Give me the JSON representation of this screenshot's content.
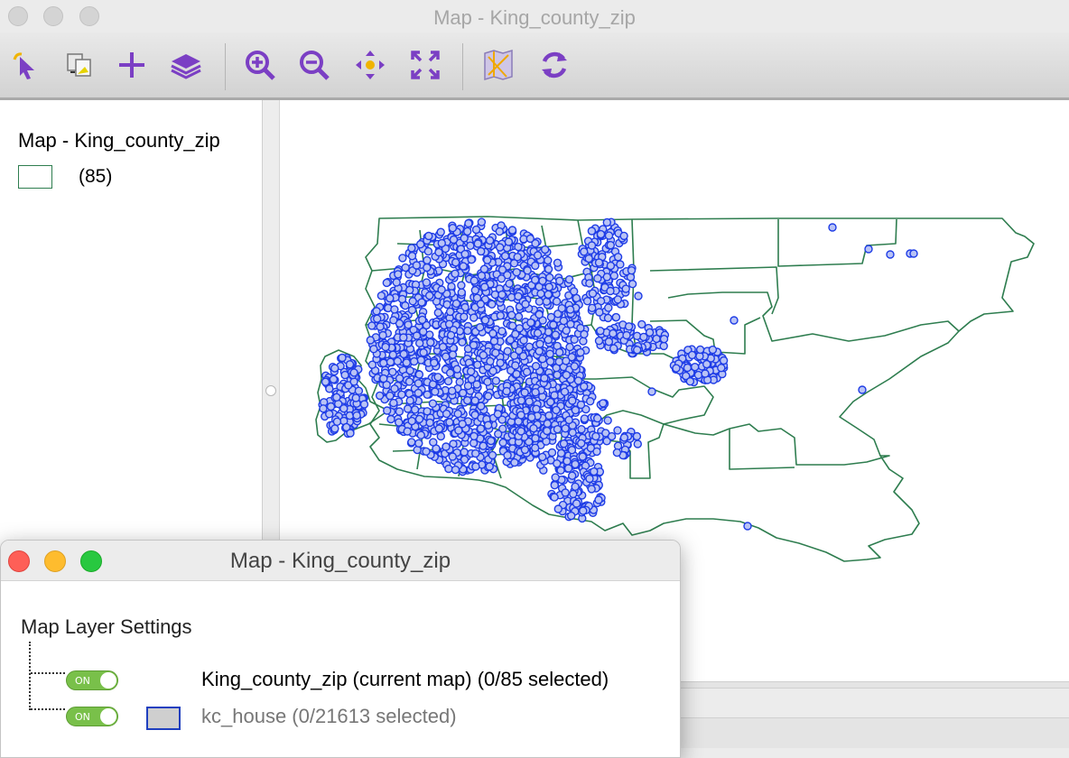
{
  "main_window": {
    "title": "Map - King_county_zip"
  },
  "toolbar": {
    "buttons": [
      {
        "icon": "select-pointer-icon",
        "name": "Select"
      },
      {
        "icon": "copy-image-icon",
        "name": "Copy"
      },
      {
        "icon": "add-layer-plus-icon",
        "name": "Add layer"
      },
      {
        "icon": "layers-icon",
        "name": "Layers"
      },
      {
        "icon": "zoom-in-icon",
        "name": "Zoom in"
      },
      {
        "icon": "zoom-out-icon",
        "name": "Zoom out"
      },
      {
        "icon": "pan-icon",
        "name": "Pan"
      },
      {
        "icon": "full-extent-icon",
        "name": "Full extent"
      },
      {
        "icon": "basemap-icon",
        "name": "Basemap"
      },
      {
        "icon": "refresh-icon",
        "name": "Refresh"
      }
    ]
  },
  "legend": {
    "title": "Map - King_county_zip",
    "count": "(85)"
  },
  "map": {
    "boundary_color": "#2e7d4f",
    "point_fill": "#b9c3f5",
    "point_stroke": "#1e3ce6"
  },
  "dialog": {
    "title": "Map - King_county_zip",
    "heading": "Map Layer Settings",
    "layers": [
      {
        "toggle": "ON",
        "label": "King_county_zip (current map) (0/85 selected)"
      },
      {
        "toggle": "ON",
        "label": "kc_house (0/21613 selected)"
      }
    ]
  }
}
